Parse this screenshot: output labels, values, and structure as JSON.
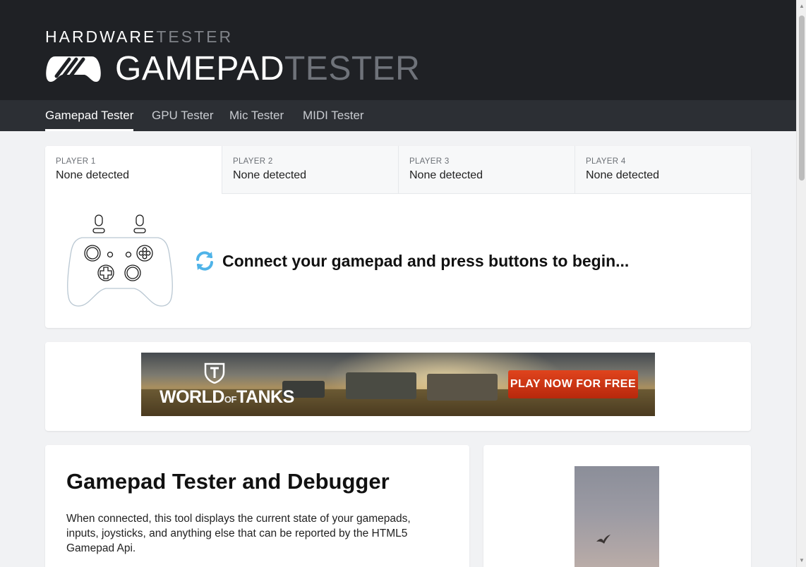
{
  "header": {
    "brand_small_a": "HARDWARE",
    "brand_small_b": "TESTER",
    "brand_big_a": "GAMEPAD",
    "brand_big_b": "TESTER",
    "logo_icon": "gamepad-logo-icon"
  },
  "nav": {
    "items": [
      {
        "label": "Gamepad Tester",
        "active": true
      },
      {
        "label": "GPU Tester",
        "active": false
      },
      {
        "label": "Mic Tester",
        "active": false
      },
      {
        "label": "MIDI Tester",
        "active": false
      }
    ]
  },
  "players": [
    {
      "label": "PLAYER 1",
      "status": "None detected"
    },
    {
      "label": "PLAYER 2",
      "status": "None detected"
    },
    {
      "label": "PLAYER 3",
      "status": "None detected"
    },
    {
      "label": "PLAYER 4",
      "status": "None detected"
    }
  ],
  "main": {
    "connect_message": "Connect your gamepad and press buttons to begin...",
    "refresh_icon": "refresh-icon",
    "controller_icon": "gamepad-outline-icon"
  },
  "ad": {
    "brand_a": "WORLD",
    "brand_of": "OF",
    "brand_b": "TANKS",
    "cta": "PLAY NOW FOR FREE"
  },
  "info": {
    "title": "Gamepad Tester and Debugger",
    "body": "When connected, this tool displays the current state of your gamepads, inputs, joysticks, and anything else that can be reported by the HTML5 Gamepad Api."
  },
  "colors": {
    "header_bg": "#1f2125",
    "nav_bg": "#2c2f34",
    "page_bg": "#f1f2f4",
    "refresh_accent": "#4fb3e8",
    "cta_red": "#d03b17"
  }
}
